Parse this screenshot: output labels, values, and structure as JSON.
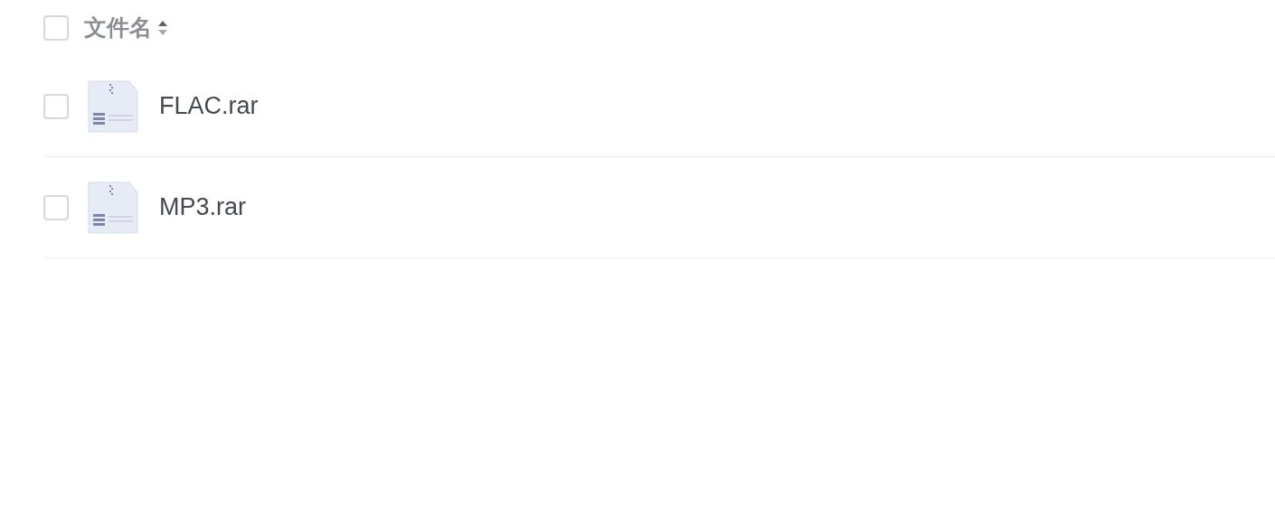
{
  "header": {
    "checked": false,
    "label": "文件名"
  },
  "files": [
    {
      "name": "FLAC.rar",
      "checked": false
    },
    {
      "name": "MP3.rar",
      "checked": false
    }
  ]
}
